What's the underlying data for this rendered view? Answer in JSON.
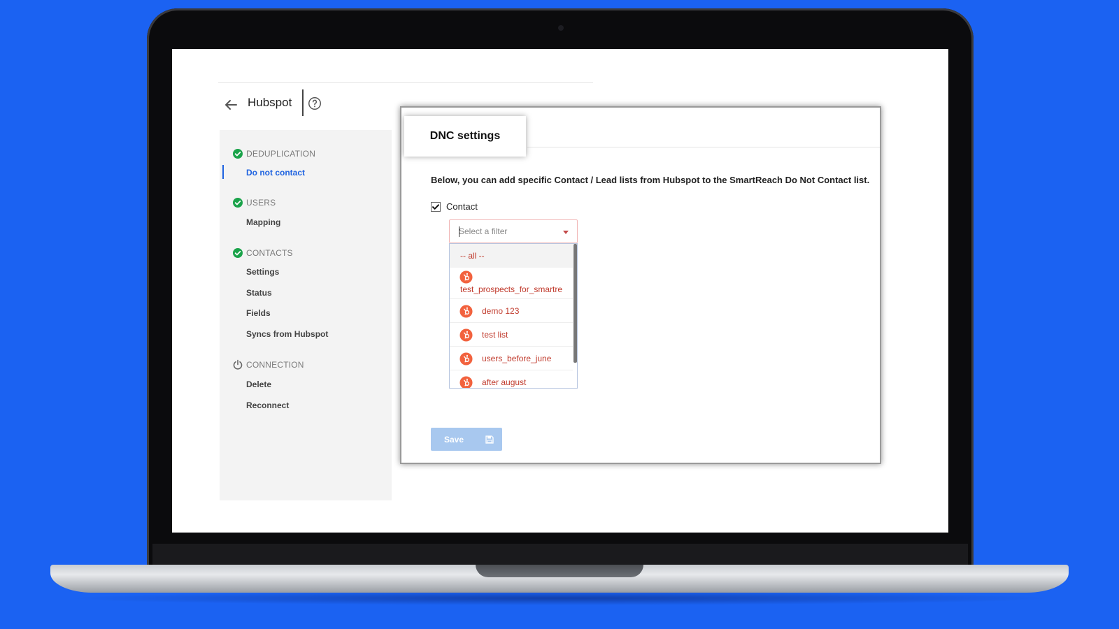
{
  "header": {
    "title": "Hubspot"
  },
  "sidebar": {
    "sections": [
      {
        "label": "DEDUPLICATION",
        "icon": "check-circle-icon",
        "items": [
          "Do not contact"
        ]
      },
      {
        "label": "USERS",
        "icon": "check-circle-icon",
        "items": [
          "Mapping"
        ]
      },
      {
        "label": "CONTACTS",
        "icon": "check-circle-icon",
        "items": [
          "Settings",
          "Status",
          "Fields",
          "Syncs from Hubspot"
        ]
      },
      {
        "label": "CONNECTION",
        "icon": "power-icon",
        "items": [
          "Delete",
          "Reconnect"
        ]
      }
    ],
    "active_item": "Do not contact"
  },
  "panel": {
    "tab_label": "DNC settings",
    "description": "Below, you can add specific Contact / Lead lists from Hubspot to the SmartReach Do Not Contact list.",
    "checkbox_label": "Contact",
    "checkbox_checked": true,
    "select": {
      "placeholder": "Select a filter",
      "options": [
        {
          "label": "-- all --",
          "icon": ""
        },
        {
          "label": "test_prospects_for_smartre",
          "icon": "hubspot-icon"
        },
        {
          "label": "demo 123",
          "icon": "hubspot-icon"
        },
        {
          "label": "test list",
          "icon": "hubspot-icon"
        },
        {
          "label": "users_before_june",
          "icon": "hubspot-icon"
        },
        {
          "label": "after august",
          "icon": "hubspot-icon"
        }
      ]
    },
    "save_label": "Save"
  },
  "colors": {
    "background": "#1b62f2",
    "accent": "#1f63e0",
    "success": "#1aa34a",
    "hubspot": "#f2623e",
    "option_text": "#c0392b",
    "save_button": "#a8c8ef"
  }
}
